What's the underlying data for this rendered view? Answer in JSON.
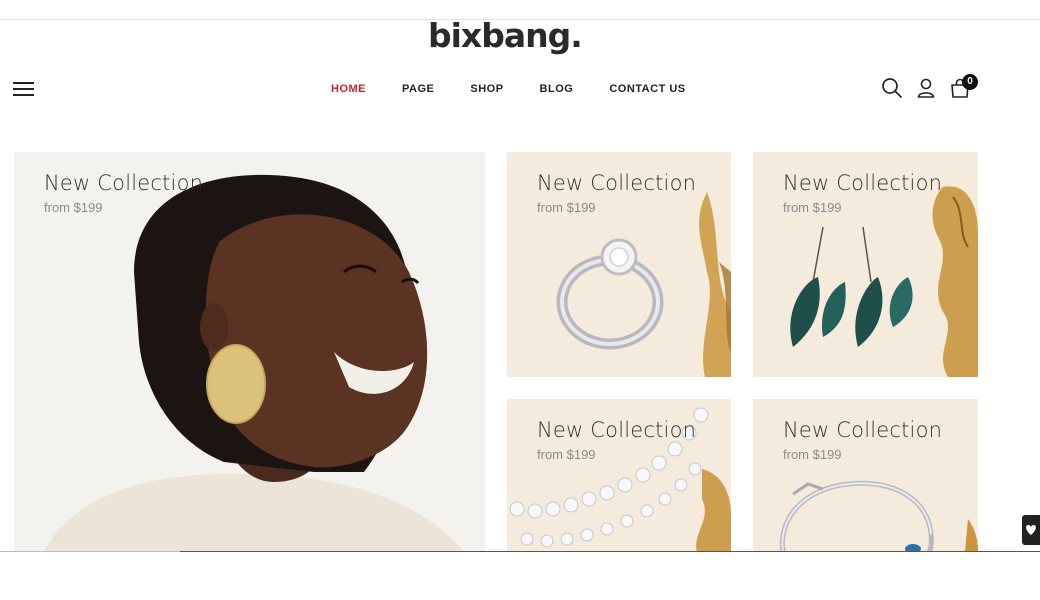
{
  "brand": {
    "logo_text": "bixbang."
  },
  "nav": {
    "items": [
      {
        "label": "HOME",
        "active": true
      },
      {
        "label": "PAGE",
        "active": false
      },
      {
        "label": "SHOP",
        "active": false
      },
      {
        "label": "BLOG",
        "active": false
      },
      {
        "label": "CONTACT US",
        "active": false
      }
    ]
  },
  "header_icons": {
    "menu": "hamburger-menu-icon",
    "search": "search-icon",
    "account": "user-icon",
    "cart": "shopping-bag-icon",
    "cart_count": "0"
  },
  "colors": {
    "accent": "#c8213a",
    "card_bg": "#f4ebdd",
    "text_dark": "#222222"
  },
  "banners": [
    {
      "title": "New Collection",
      "price": "from $199",
      "image": "woman-with-gold-earring"
    },
    {
      "title": "New Collection",
      "price": "from $199",
      "image": "diamond-ring"
    },
    {
      "title": "New Collection",
      "price": "from $199",
      "image": "feather-earrings"
    },
    {
      "title": "New Collection",
      "price": "from $199",
      "image": "diamond-necklace"
    },
    {
      "title": "New Collection",
      "price": "from $199",
      "image": "silver-bracelet"
    }
  ],
  "side_tab": {
    "icon": "heart-icon"
  }
}
